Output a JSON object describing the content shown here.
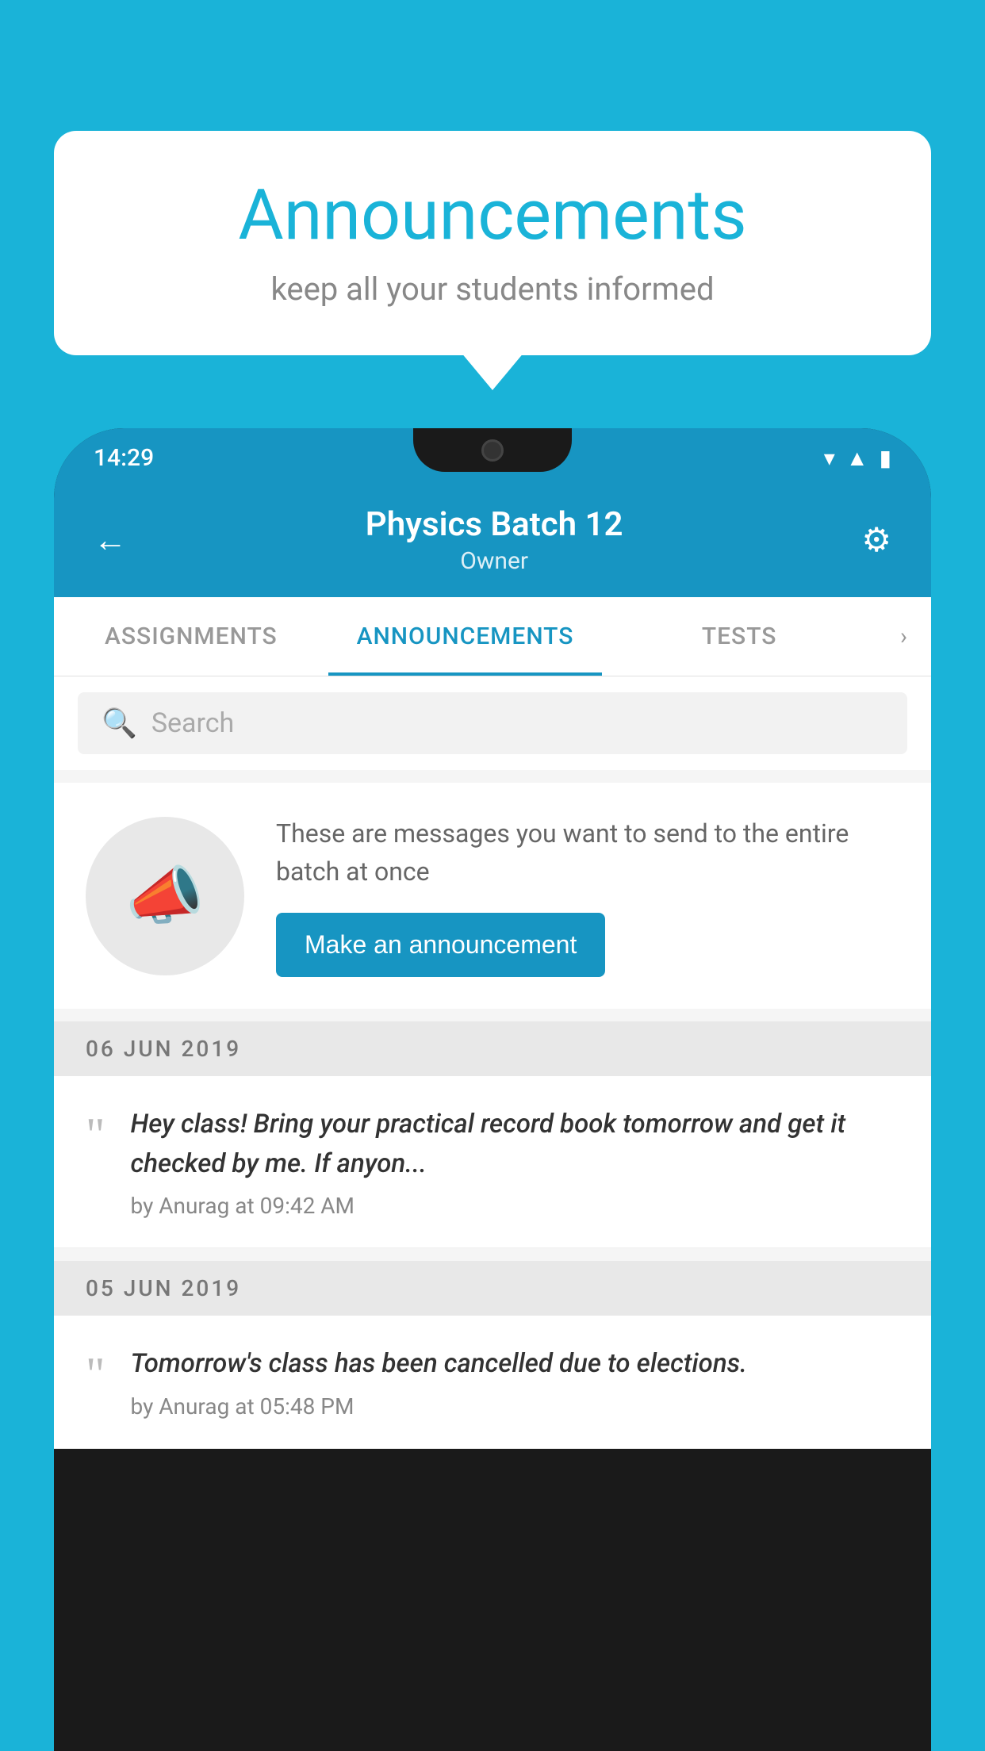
{
  "background_color": "#1ab3d8",
  "bubble": {
    "title": "Announcements",
    "subtitle": "keep all your students informed"
  },
  "phone": {
    "status_bar": {
      "time": "14:29",
      "icons": [
        "wifi",
        "signal",
        "battery"
      ]
    },
    "header": {
      "title": "Physics Batch 12",
      "subtitle": "Owner",
      "back_label": "←",
      "settings_label": "⚙"
    },
    "tabs": [
      {
        "label": "ASSIGNMENTS",
        "active": false
      },
      {
        "label": "ANNOUNCEMENTS",
        "active": true
      },
      {
        "label": "TESTS",
        "active": false
      }
    ],
    "search": {
      "placeholder": "Search"
    },
    "promo": {
      "description": "These are messages you want to send to the entire batch at once",
      "button_label": "Make an announcement"
    },
    "announcements": [
      {
        "date": "06  JUN  2019",
        "message": "Hey class! Bring your practical record book tomorrow and get it checked by me. If anyon...",
        "meta": "by Anurag at 09:42 AM"
      },
      {
        "date": "05  JUN  2019",
        "message": "Tomorrow's class has been cancelled due to elections.",
        "meta": "by Anurag at 05:48 PM"
      }
    ]
  }
}
